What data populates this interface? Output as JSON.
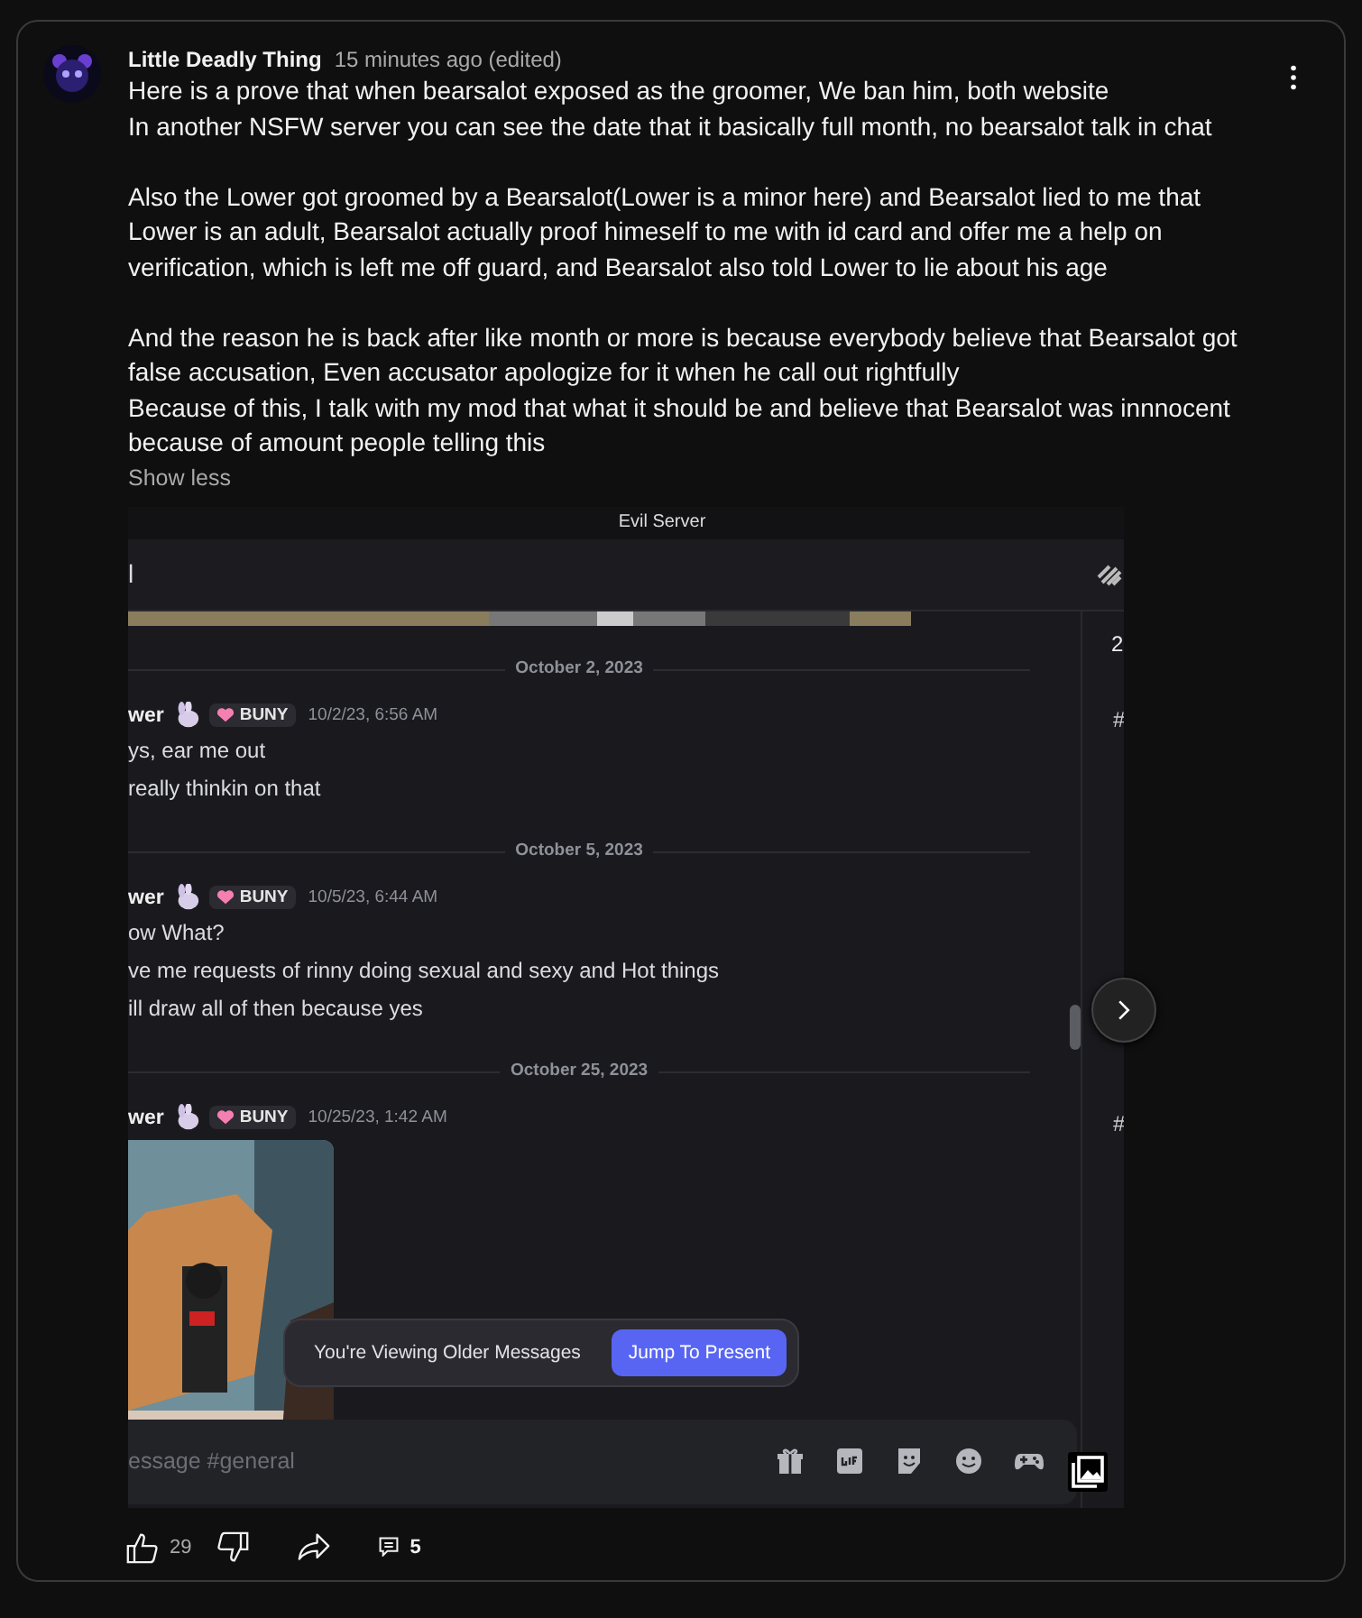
{
  "post": {
    "author": "Little Deadly Thing",
    "time": "15 minutes ago (edited)",
    "body": "Here is a prove that when bearsalot exposed as the groomer, We ban him, both website\nIn another NSFW server you can see the date that it basically full month, no bearsalot talk in chat\n\nAlso the Lower got groomed by a Bearsalot(Lower is a minor here) and Bearsalot lied to me that\nLower is an adult, Bearsalot actually proof himeself to me with id card and offer me a help on\nverification, which is left me off guard, and Bearsalot also told Lower to lie about his age\n\nAnd the reason he is back after like month or more is because everybody believe that Bearsalot got\nfalse accusation, Even accusator apologize for it when he call out rightfully\nBecause of this, I talk with my mod that what it should be and believe that Bearsalot was innnocent\nbecause of amount people telling this",
    "toggle": "Show less"
  },
  "embed": {
    "server": "Evil Server",
    "channel": "l",
    "sidebar_count": "2",
    "sidebar_marks": [
      "#",
      "#"
    ],
    "messages": [
      {
        "kind": "divider",
        "date": "October 2, 2023"
      },
      {
        "kind": "message",
        "author": "wer",
        "tag": "BUNY",
        "time": "10/2/23, 6:56 AM",
        "lines": [
          "ys, ear me out",
          "really thinkin on that"
        ]
      },
      {
        "kind": "divider",
        "date": "October 5, 2023"
      },
      {
        "kind": "message",
        "author": "wer",
        "tag": "BUNY",
        "time": "10/5/23, 6:44 AM",
        "lines": [
          "ow What?",
          "ve me requests of rinny doing sexual and sexy and Hot things",
          "ill draw all of then because yes"
        ]
      },
      {
        "kind": "divider",
        "date": "October 25, 2023"
      },
      {
        "author": "wer",
        "tag": "BUNY",
        "time": "10/25/23, 1:42 AM"
      }
    ],
    "banner": {
      "text": "You're Viewing Older Messages",
      "button": "Jump To Present"
    },
    "composer": {
      "placeholder": "essage #general"
    }
  },
  "actions": {
    "likes": "29",
    "comments": "5"
  }
}
